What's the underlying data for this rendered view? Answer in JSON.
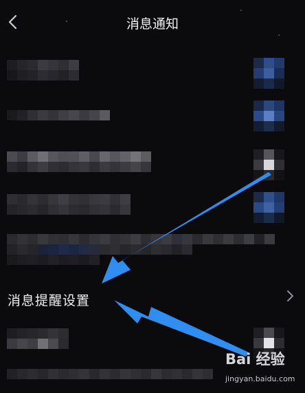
{
  "header": {
    "title": "消息通知",
    "back_icon": "chevron-left-icon"
  },
  "setting": {
    "label": "消息提醒设置",
    "chevron_icon": "chevron-right-icon"
  },
  "watermark": {
    "logo": "Bai 经验",
    "url": "jingyan.baidu.com"
  },
  "colors": {
    "background": "#0b0b0d",
    "arrow": "#2f8ef0",
    "toggle_on": "#2e4d8a"
  }
}
